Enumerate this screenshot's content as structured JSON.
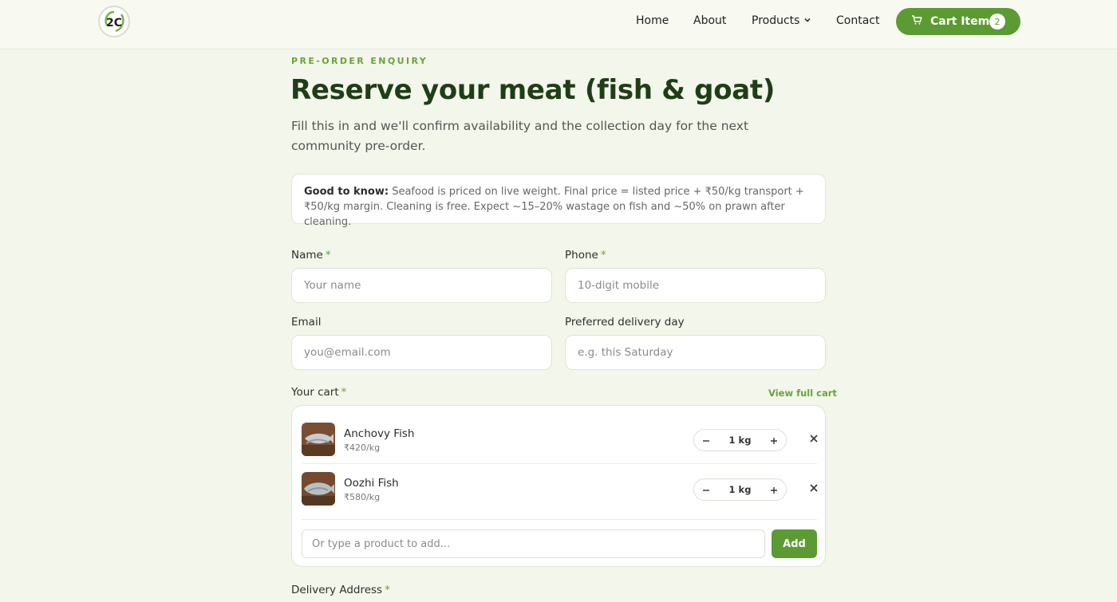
{
  "header": {
    "logo_text": "2C",
    "nav": {
      "home": "Home",
      "about": "About",
      "products": "Products",
      "contact": "Contact"
    },
    "cart_label": "Cart Items",
    "cart_count": "2"
  },
  "intro": {
    "eyebrow": "PRE-ORDER ENQUIRY",
    "title": "Reserve your meat (fish & goat)",
    "subtitle": "Fill this in and we'll confirm availability and the collection day for the next community pre-order."
  },
  "note": {
    "lead": "Good to know:",
    "text": " Seafood is priced on live weight. Final price = listed price + ₹50/kg transport + ₹50/kg margin. Cleaning is free. Expect ~15–20% wastage on fish and ~50% on prawn after cleaning."
  },
  "form": {
    "required_mark": "*",
    "name": {
      "label": "Name",
      "placeholder": "Your name",
      "value": ""
    },
    "phone": {
      "label": "Phone",
      "placeholder": "10-digit mobile",
      "value": ""
    },
    "email": {
      "label": "Email",
      "placeholder": "you@email.com",
      "value": ""
    },
    "delivery_day": {
      "label": "Preferred delivery day",
      "placeholder": "e.g. this Saturday",
      "value": ""
    },
    "cart_label": "Your cart",
    "view_full_cart": "View full cart",
    "address_label": "Delivery Address"
  },
  "cart": {
    "items": [
      {
        "name": "Anchovy Fish",
        "price": "₹420/kg",
        "qty": "1 kg"
      },
      {
        "name": "Oozhi Fish",
        "price": "₹580/kg",
        "qty": "1 kg"
      }
    ],
    "add_placeholder": "Or type a product to add...",
    "add_button": "Add"
  },
  "colors": {
    "accent": "#5c9a33",
    "heading": "#1f3d17",
    "background": "#f3f6ea"
  }
}
